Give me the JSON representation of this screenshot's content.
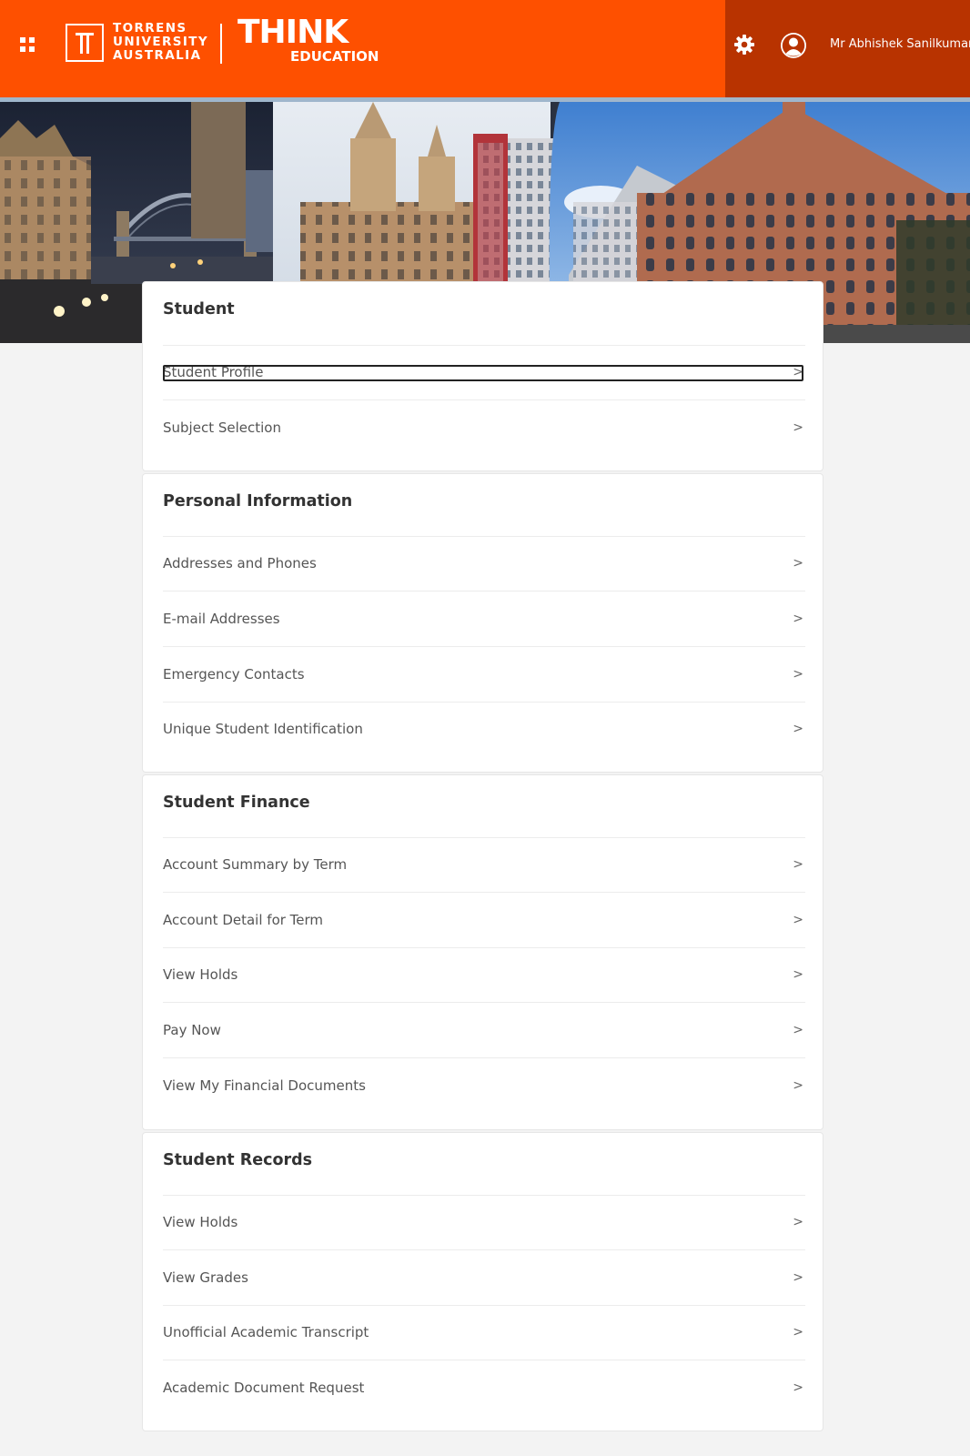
{
  "brand": {
    "university_lines": [
      "TORRENS",
      "UNIVERSITY",
      "AUSTRALIA"
    ],
    "think": "THINK",
    "education": "EDUCATION",
    "primary_color": "#fe5000",
    "dark_color": "#b83300"
  },
  "header": {
    "user_name": "Mr Abhishek Sanilkumar",
    "icons": [
      "apps-grid-icon",
      "gear-icon",
      "user-avatar-icon"
    ]
  },
  "sections": [
    {
      "title": "Student",
      "items": [
        {
          "label": "Student Profile",
          "chevron": ">"
        },
        {
          "label": "Subject Selection",
          "chevron": ">"
        }
      ]
    },
    {
      "title": "Personal Information",
      "items": [
        {
          "label": "Addresses and Phones",
          "chevron": ">"
        },
        {
          "label": "E-mail Addresses",
          "chevron": ">"
        },
        {
          "label": "Emergency Contacts",
          "chevron": ">"
        },
        {
          "label": "Unique Student Identification",
          "chevron": ">"
        }
      ]
    },
    {
      "title": "Student Finance",
      "items": [
        {
          "label": "Account Summary by Term",
          "chevron": ">"
        },
        {
          "label": "Account Detail for Term",
          "chevron": ">"
        },
        {
          "label": "View Holds",
          "chevron": ">"
        },
        {
          "label": "Pay Now",
          "chevron": ">"
        },
        {
          "label": "View My Financial Documents",
          "chevron": ">"
        }
      ]
    },
    {
      "title": "Student Records",
      "items": [
        {
          "label": "View Holds",
          "chevron": ">"
        },
        {
          "label": "View Grades",
          "chevron": ">"
        },
        {
          "label": "Unofficial Academic Transcript",
          "chevron": ">"
        },
        {
          "label": "Academic Document Request",
          "chevron": ">"
        }
      ]
    }
  ]
}
